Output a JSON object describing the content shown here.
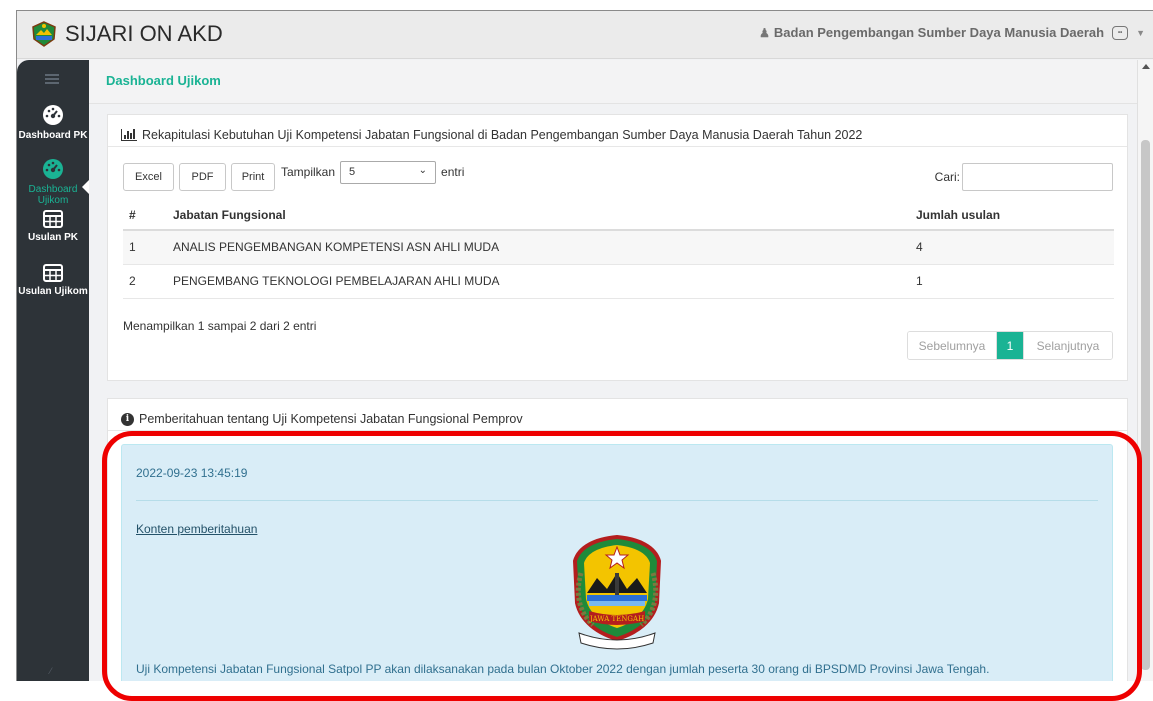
{
  "app": {
    "title": "SIJARI ON AKD",
    "user_name": "Badan Pengembangan Sumber Daya Manusia Daerah"
  },
  "sidebar": {
    "items": [
      {
        "label": "Dashboard PK",
        "icon": "dashboard-gauge-icon"
      },
      {
        "label": "Dashboard Ujikom",
        "icon": "dashboard-gauge-icon",
        "active": true
      },
      {
        "label": "Usulan PK",
        "icon": "table-grid-icon"
      },
      {
        "label": "Usulan Ujikom",
        "icon": "table-grid-icon"
      }
    ]
  },
  "page": {
    "title": "Dashboard Ujikom"
  },
  "recap": {
    "title": "Rekapitulasi Kebutuhan Uji Kompetensi Jabatan Fungsional di Badan Pengembangan Sumber Daya Manusia Daerah Tahun 2022",
    "buttons": {
      "excel": "Excel",
      "pdf": "PDF",
      "print": "Print"
    },
    "length_prefix": "Tampilkan",
    "length_value": "5",
    "length_suffix": "entri",
    "search_label": "Cari:",
    "search_value": "",
    "columns": [
      "#",
      "Jabatan Fungsional",
      "Jumlah usulan"
    ],
    "rows": [
      {
        "no": "1",
        "jabatan": "ANALIS PENGEMBANGAN KOMPETENSI ASN AHLI MUDA",
        "jumlah": "4"
      },
      {
        "no": "2",
        "jabatan": "PENGEMBANG TEKNOLOGI PEMBELAJARAN AHLI MUDA",
        "jumlah": "1"
      }
    ],
    "info": "Menampilkan 1 sampai 2 dari 2 entri",
    "pagination": {
      "prev": "Sebelumnya",
      "current": "1",
      "next": "Selanjutnya"
    }
  },
  "notice": {
    "title": "Pemberitahuan tentang Uji Kompetensi Jabatan Fungsional Pemprov",
    "timestamp": "2022-09-23 13:45:19",
    "link": "Konten pemberitahuan",
    "emblem_text": "JAWA TENGAH",
    "message": "Uji Kompetensi Jabatan Fungsional Satpol PP akan dilaksanakan pada bulan Oktober 2022 dengan jumlah peserta 30 orang di BPSDMD Provinsi Jawa Tengah."
  },
  "colors": {
    "accent": "#1ab394",
    "sidebar_bg": "#2d3338",
    "alert_bg": "#d9edf7",
    "highlight": "#ee0000"
  }
}
